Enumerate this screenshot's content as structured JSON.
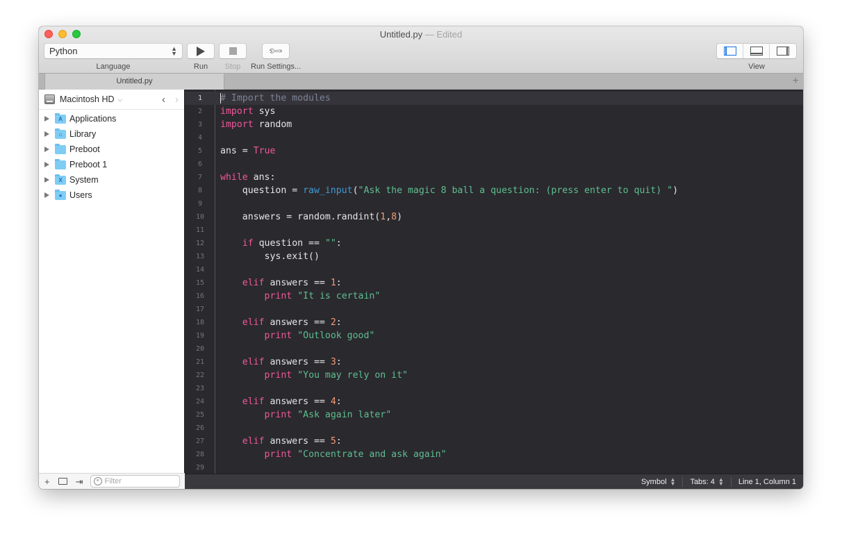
{
  "window": {
    "title": "Untitled.py",
    "title_suffix": "— Edited",
    "traffic_lights": {
      "close": "#fe5f57",
      "minimize": "#febc2e",
      "maximize": "#28c840"
    }
  },
  "toolbar": {
    "language": {
      "value": "Python",
      "label": "Language"
    },
    "run": {
      "label": "Run",
      "icon": "play-icon"
    },
    "stop": {
      "label": "Stop",
      "icon": "stop-icon",
      "enabled": false
    },
    "run_settings": {
      "label": "Run Settings...",
      "icon": "wrench-icon"
    },
    "view": {
      "label": "View",
      "options": [
        "left-pane",
        "bottom-pane",
        "right-pane"
      ],
      "active": "left-pane"
    }
  },
  "tabs": [
    {
      "label": "Untitled.py",
      "active": true
    }
  ],
  "tab_add_label": "+",
  "sidebar": {
    "volume": "Macintosh HD",
    "items": [
      {
        "label": "Applications",
        "icon": "applications-folder-icon",
        "glyph": "A"
      },
      {
        "label": "Library",
        "icon": "library-folder-icon",
        "glyph": "⌂"
      },
      {
        "label": "Preboot",
        "icon": "folder-icon",
        "glyph": ""
      },
      {
        "label": "Preboot 1",
        "icon": "folder-icon",
        "glyph": ""
      },
      {
        "label": "System",
        "icon": "system-folder-icon",
        "glyph": "X"
      },
      {
        "label": "Users",
        "icon": "users-folder-icon",
        "glyph": "●"
      }
    ],
    "footer": {
      "filter_placeholder": "Filter"
    }
  },
  "editor": {
    "current_line": 1,
    "lines": [
      [
        [
          "cm",
          "# Import the modules"
        ]
      ],
      [
        [
          "kw",
          "import"
        ],
        [
          "tx",
          " sys"
        ]
      ],
      [
        [
          "kw",
          "import"
        ],
        [
          "tx",
          " random"
        ]
      ],
      [],
      [
        [
          "tx",
          "ans = "
        ],
        [
          "kw",
          "True"
        ]
      ],
      [],
      [
        [
          "kw",
          "while"
        ],
        [
          "tx",
          " ans:"
        ]
      ],
      [
        [
          "tx",
          "    question = "
        ],
        [
          "fn",
          "raw_input"
        ],
        [
          "tx",
          "("
        ],
        [
          "str",
          "\"Ask the magic 8 ball a question: (press enter to quit) \""
        ],
        [
          "tx",
          ")"
        ]
      ],
      [],
      [
        [
          "tx",
          "    answers = random.randint("
        ],
        [
          "num",
          "1"
        ],
        [
          "tx",
          ","
        ],
        [
          "num",
          "8"
        ],
        [
          "tx",
          ")"
        ]
      ],
      [],
      [
        [
          "tx",
          "    "
        ],
        [
          "kw",
          "if"
        ],
        [
          "tx",
          " question == "
        ],
        [
          "str",
          "\"\""
        ],
        [
          "tx",
          ":"
        ]
      ],
      [
        [
          "tx",
          "        sys.exit()"
        ]
      ],
      [],
      [
        [
          "tx",
          "    "
        ],
        [
          "kw",
          "elif"
        ],
        [
          "tx",
          " answers == "
        ],
        [
          "num",
          "1"
        ],
        [
          "tx",
          ":"
        ]
      ],
      [
        [
          "tx",
          "        "
        ],
        [
          "kw",
          "print"
        ],
        [
          "tx",
          " "
        ],
        [
          "str",
          "\"It is certain\""
        ]
      ],
      [],
      [
        [
          "tx",
          "    "
        ],
        [
          "kw",
          "elif"
        ],
        [
          "tx",
          " answers == "
        ],
        [
          "num",
          "2"
        ],
        [
          "tx",
          ":"
        ]
      ],
      [
        [
          "tx",
          "        "
        ],
        [
          "kw",
          "print"
        ],
        [
          "tx",
          " "
        ],
        [
          "str",
          "\"Outlook good\""
        ]
      ],
      [],
      [
        [
          "tx",
          "    "
        ],
        [
          "kw",
          "elif"
        ],
        [
          "tx",
          " answers == "
        ],
        [
          "num",
          "3"
        ],
        [
          "tx",
          ":"
        ]
      ],
      [
        [
          "tx",
          "        "
        ],
        [
          "kw",
          "print"
        ],
        [
          "tx",
          " "
        ],
        [
          "str",
          "\"You may rely on it\""
        ]
      ],
      [],
      [
        [
          "tx",
          "    "
        ],
        [
          "kw",
          "elif"
        ],
        [
          "tx",
          " answers == "
        ],
        [
          "num",
          "4"
        ],
        [
          "tx",
          ":"
        ]
      ],
      [
        [
          "tx",
          "        "
        ],
        [
          "kw",
          "print"
        ],
        [
          "tx",
          " "
        ],
        [
          "str",
          "\"Ask again later\""
        ]
      ],
      [],
      [
        [
          "tx",
          "    "
        ],
        [
          "kw",
          "elif"
        ],
        [
          "tx",
          " answers == "
        ],
        [
          "num",
          "5"
        ],
        [
          "tx",
          ":"
        ]
      ],
      [
        [
          "tx",
          "        "
        ],
        [
          "kw",
          "print"
        ],
        [
          "tx",
          " "
        ],
        [
          "str",
          "\"Concentrate and ask again\""
        ]
      ],
      []
    ]
  },
  "statusbar": {
    "symbol": "Symbol",
    "tabs": "Tabs: 4",
    "position": "Line 1, Column 1"
  },
  "colors": {
    "keyword": "#f0589c",
    "string": "#5fbf8f",
    "number": "#f59b74",
    "function": "#3f9bd6",
    "comment": "#7c8497",
    "editor_bg": "#2a292e",
    "accent": "#1a73e8"
  }
}
